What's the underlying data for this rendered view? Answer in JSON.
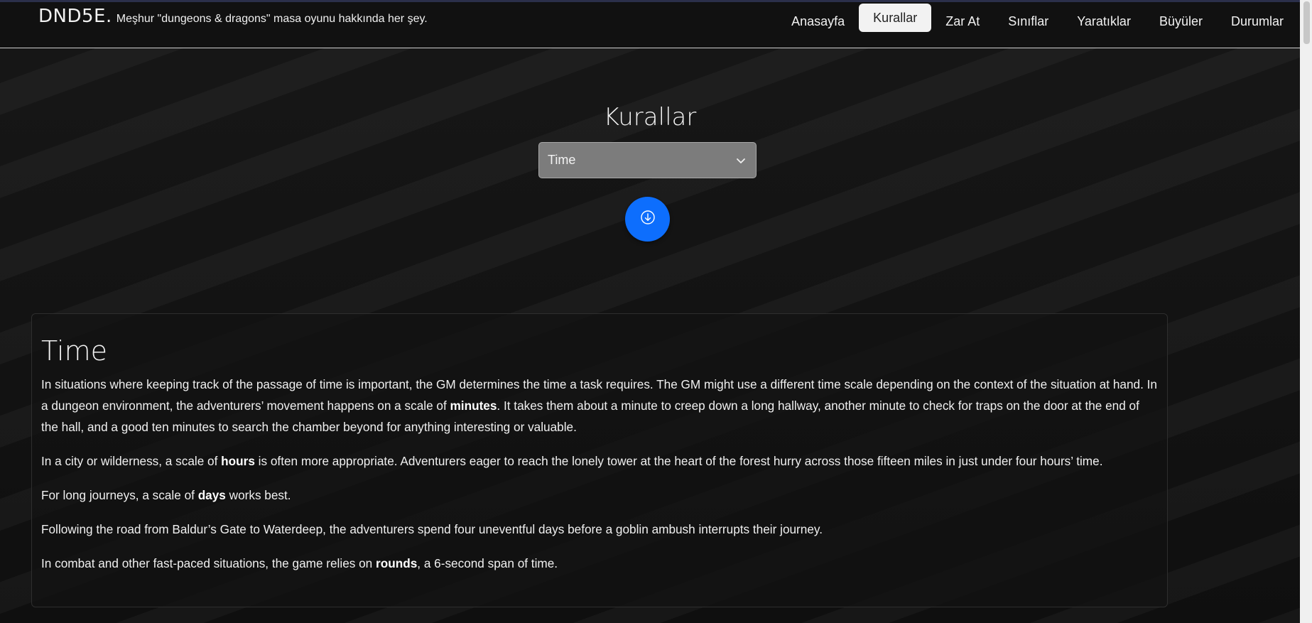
{
  "header": {
    "brand_title": "DND5E.",
    "brand_subtitle": "Meşhur \"dungeons & dragons\" masa oyunu hakkında her şey.",
    "nav": [
      {
        "label": "Anasayfa",
        "active": false
      },
      {
        "label": "Kurallar",
        "active": true
      },
      {
        "label": "Zar At",
        "active": false
      },
      {
        "label": "Sınıflar",
        "active": false
      },
      {
        "label": "Yaratıklar",
        "active": false
      },
      {
        "label": "Büyüler",
        "active": false
      },
      {
        "label": "Durumlar",
        "active": false
      }
    ]
  },
  "main": {
    "heading": "Kurallar",
    "select": {
      "value": "Time",
      "icon": "chevron-down-icon"
    },
    "download_button": {
      "icon": "arrow-down-circle-icon",
      "color": "#0d6efd"
    }
  },
  "card": {
    "title": "Time",
    "paragraphs": [
      {
        "before": "In situations where keeping track of the passage of time is important, the GM determines the time a task requires. The GM might use a different time scale depending on the context of the situation at hand. In a dungeon environment, the adventurers’ movement happens on a scale of ",
        "bold": "minutes",
        "after": ". It takes them about a minute to creep down a long hallway, another minute to check for traps on the door at the end of the hall, and a good ten minutes to search the chamber beyond for anything interesting or valuable."
      },
      {
        "before": "In a city or wilderness, a scale of ",
        "bold": "hours",
        "after": " is often more appropriate. Adventurers eager to reach the lonely tower at the heart of the forest hurry across those fifteen miles in just under four hours’ time."
      },
      {
        "before": "For long journeys, a scale of ",
        "bold": "days",
        "after": " works best."
      },
      {
        "before": "Following the road from Baldur’s Gate to Waterdeep, the adventurers spend four uneventful days before a goblin ambush interrupts their journey.",
        "bold": "",
        "after": ""
      },
      {
        "before": "In combat and other fast-paced situations, the game relies on ",
        "bold": "rounds",
        "after": ", a 6-second span of time."
      }
    ]
  }
}
